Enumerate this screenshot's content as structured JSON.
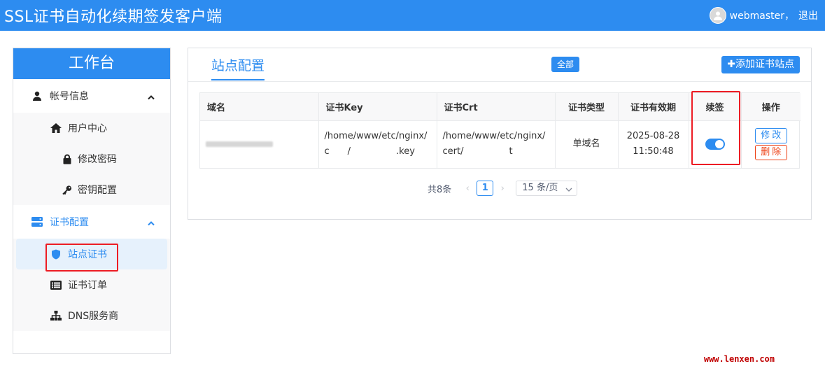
{
  "header": {
    "title": "SSL证书自动化续期签发客户端",
    "username": "webmaster，",
    "logout": "退出"
  },
  "sidebar": {
    "title": "工作台",
    "groups": [
      {
        "label": "帐号信息",
        "icon": "user-icon",
        "items": [
          {
            "label": "用户中心",
            "icon": "home-icon"
          },
          {
            "label": "修改密码",
            "icon": "lock-icon"
          },
          {
            "label": "密钥配置",
            "icon": "key-icon"
          }
        ]
      },
      {
        "label": "证书配置",
        "icon": "server-icon",
        "items": [
          {
            "label": "站点证书",
            "icon": "shield-icon"
          },
          {
            "label": "证书订单",
            "icon": "list-icon"
          },
          {
            "label": "DNS服务商",
            "icon": "sitemap-icon"
          }
        ]
      }
    ]
  },
  "card": {
    "tab": "站点配置",
    "badge": "全部",
    "add_button": "✚添加证书站点"
  },
  "table": {
    "columns": [
      "域名",
      "证书Key",
      "证书Crt",
      "证书类型",
      "证书有效期",
      "续签",
      "操作"
    ],
    "rows": [
      {
        "key_line1": "/home/www/etc/nginx/",
        "key_line2": "c  /     .key",
        "crt_line1": "/home/www/etc/nginx/",
        "crt_line2": "cert/     t",
        "type": "单域名",
        "date": "2025-08-28",
        "time": "11:50:48",
        "renew": true,
        "edit": "修改",
        "delete": "删除"
      }
    ]
  },
  "pager": {
    "total": "共8条",
    "current": "1",
    "page_size": "15 条/页"
  },
  "watermark": "www.lenxen.com",
  "colors": {
    "primary": "#2d8cf0",
    "danger": "#ed4014",
    "highlight_box": "#ed1c24"
  }
}
